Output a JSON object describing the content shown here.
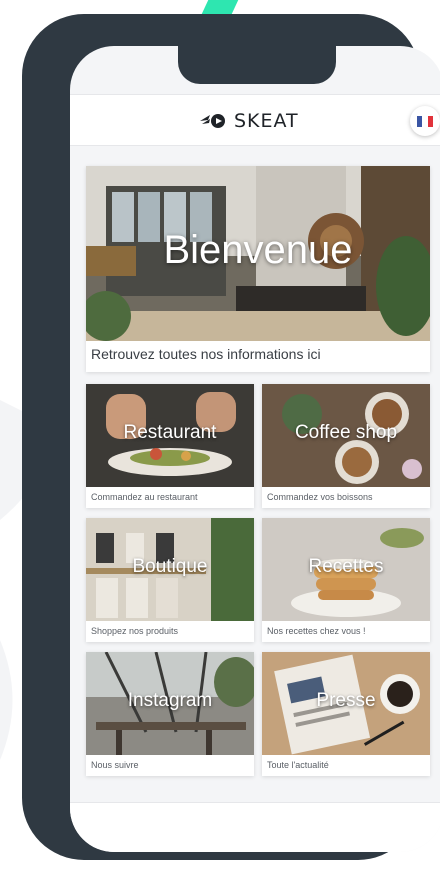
{
  "app": {
    "brand": "SKEAT",
    "language_flag": "french-flag-icon",
    "colors": {
      "phone_frame": "#2f3942",
      "accent": "#2ee6b0",
      "background": "#f4f5f7"
    }
  },
  "hero": {
    "title": "Bienvenue",
    "subtitle": "Retrouvez toutes nos informations ici"
  },
  "tiles": [
    {
      "title": "Restaurant",
      "subtitle": "Commandez au restaurant"
    },
    {
      "title": "Coffee shop",
      "subtitle": "Commandez vos boissons"
    },
    {
      "title": "Boutique",
      "subtitle": "Shoppez nos produits"
    },
    {
      "title": "Recettes",
      "subtitle": "Nos recettes chez vous !"
    },
    {
      "title": "Instagram",
      "subtitle": "Nous suivre"
    },
    {
      "title": "Presse",
      "subtitle": "Toute l'actualité"
    }
  ]
}
